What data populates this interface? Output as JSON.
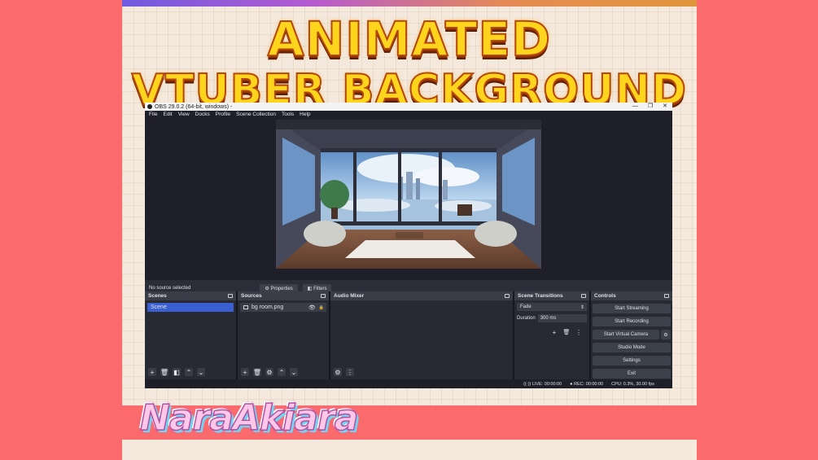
{
  "banner": {
    "line1": "ANIMATED",
    "line2": "VTUBER BACKGROUND"
  },
  "watermark": "NaraAkiara",
  "window": {
    "title": "OBS 29.0.2 (64-bit, windows) -",
    "controls": {
      "minimize": "—",
      "maximize": "❐",
      "close": "✕"
    }
  },
  "menu": [
    "File",
    "Edit",
    "View",
    "Docks",
    "Profile",
    "Scene Collection",
    "Tools",
    "Help"
  ],
  "status": {
    "no_source": "No source selected",
    "properties": "Properties",
    "filters": "Filters"
  },
  "docks": {
    "scenes": {
      "title": "Scenes",
      "items": [
        "Scene"
      ]
    },
    "sources": {
      "title": "Sources",
      "items": [
        "bg room.png"
      ]
    },
    "audio": {
      "title": "Audio Mixer"
    },
    "transitions": {
      "title": "Scene Transitions",
      "type": "Fade",
      "duration_label": "Duration",
      "duration_value": "300 ms"
    },
    "controls": {
      "title": "Controls",
      "start_streaming": "Start Streaming",
      "start_recording": "Start Recording",
      "start_virtual_camera": "Start Virtual Camera",
      "studio_mode": "Studio Mode",
      "settings": "Settings",
      "exit": "Exit"
    }
  },
  "bottom": {
    "live": "LIVE: 00:00:00",
    "rec": "REC: 00:00:00",
    "cpu": "CPU: 0.3%, 30.00 fps"
  },
  "icons": {
    "add": "+",
    "remove": "🗑",
    "filter": "◧",
    "up": "⌃",
    "down": "⌄",
    "gear": "⚙",
    "more": "⋮",
    "eye": "👁",
    "lock": "🔒"
  }
}
